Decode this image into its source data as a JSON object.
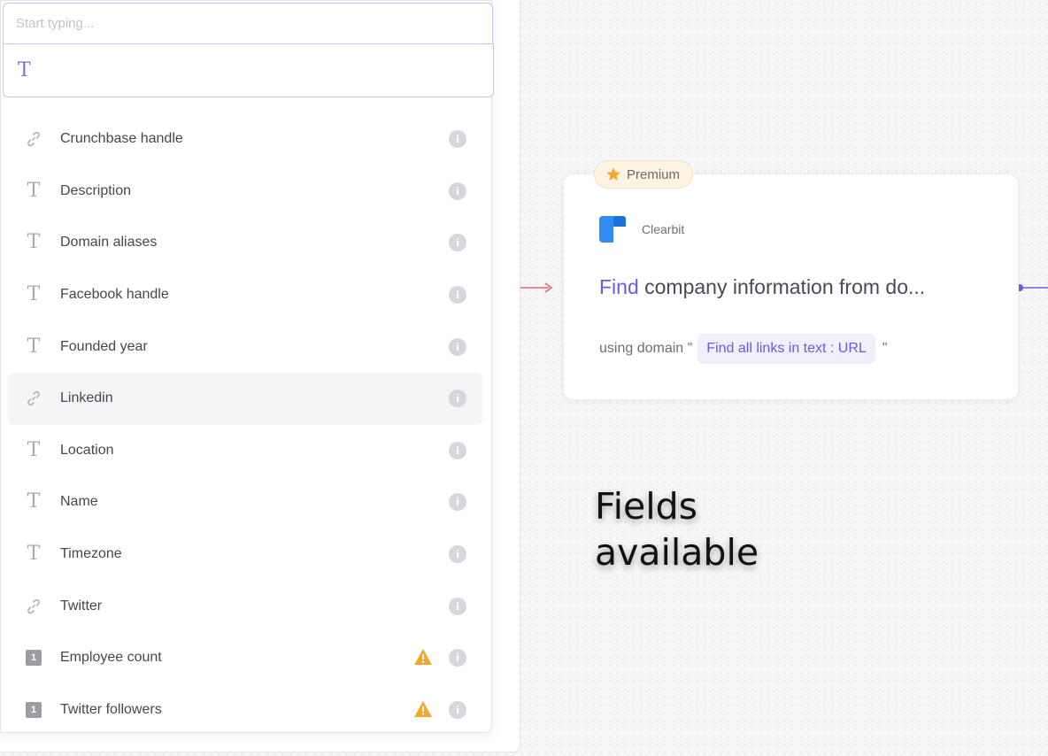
{
  "search": {
    "placeholder": "Start typing..."
  },
  "type_field": {
    "glyph": "T"
  },
  "items": [
    {
      "label": "Crunchbase handle",
      "icon": "link-icon",
      "warning": false
    },
    {
      "label": "Description",
      "icon": "text-icon",
      "warning": false
    },
    {
      "label": "Domain aliases",
      "icon": "text-icon",
      "warning": false
    },
    {
      "label": "Facebook handle",
      "icon": "text-icon",
      "warning": false
    },
    {
      "label": "Founded year",
      "icon": "text-icon",
      "warning": false
    },
    {
      "label": "Linkedin",
      "icon": "link-icon",
      "warning": false,
      "highlighted": true
    },
    {
      "label": "Location",
      "icon": "text-icon",
      "warning": false
    },
    {
      "label": "Name",
      "icon": "text-icon",
      "warning": false
    },
    {
      "label": "Timezone",
      "icon": "text-icon",
      "warning": false
    },
    {
      "label": "Twitter",
      "icon": "link-icon",
      "warning": false
    },
    {
      "label": "Employee count",
      "icon": "number-icon",
      "warning": true
    },
    {
      "label": "Twitter followers",
      "icon": "number-icon",
      "warning": true
    }
  ],
  "card": {
    "badge": "Premium",
    "brand": "Clearbit",
    "title_verb": "Find",
    "title_rest": " company information from do...",
    "using_prefix": "using domain \"",
    "chip": "Find all links in text : URL",
    "using_suffix": "\""
  },
  "annotation": {
    "line1": "Fields",
    "line2": "available"
  },
  "colors": {
    "accent": "#7158e2",
    "arrow_in": "#e5656b",
    "connector": "#6c5ce7",
    "warning": "#f0a830"
  }
}
